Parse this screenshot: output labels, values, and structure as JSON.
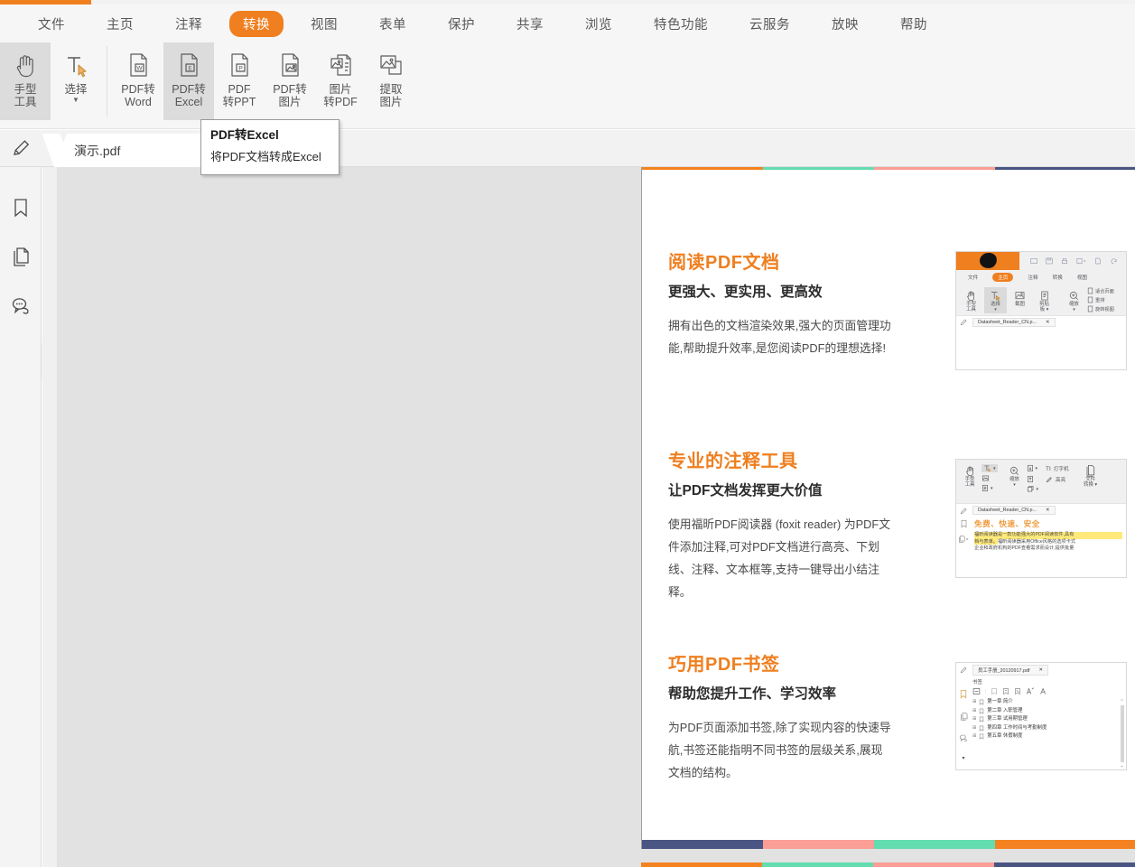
{
  "menubar": {
    "items": [
      {
        "label": "文件",
        "active": false
      },
      {
        "label": "主页",
        "active": false
      },
      {
        "label": "注释",
        "active": false
      },
      {
        "label": "转换",
        "active": true
      },
      {
        "label": "视图",
        "active": false
      },
      {
        "label": "表单",
        "active": false
      },
      {
        "label": "保护",
        "active": false
      },
      {
        "label": "共享",
        "active": false
      },
      {
        "label": "浏览",
        "active": false
      },
      {
        "label": "特色功能",
        "active": false
      },
      {
        "label": "云服务",
        "active": false
      },
      {
        "label": "放映",
        "active": false
      },
      {
        "label": "帮助",
        "active": false
      }
    ]
  },
  "ribbon": {
    "buttons": [
      {
        "name": "hand-tool",
        "label": "手型\n工具",
        "icon": "hand-icon",
        "selected": true,
        "caret": false
      },
      {
        "name": "select-tool",
        "label": "选择",
        "icon": "text-select-icon",
        "selected": false,
        "caret": true
      },
      {
        "name": "pdf-to-word",
        "label": "PDF转\nWord",
        "icon": "doc-word-icon",
        "selected": false,
        "caret": false
      },
      {
        "name": "pdf-to-excel",
        "label": "PDF转\nExcel",
        "icon": "doc-excel-icon",
        "selected": true,
        "caret": false
      },
      {
        "name": "pdf-to-ppt",
        "label": "PDF\n转PPT",
        "icon": "doc-ppt-icon",
        "selected": false,
        "caret": false
      },
      {
        "name": "pdf-to-image",
        "label": "PDF转\n图片",
        "icon": "doc-image-icon",
        "selected": false,
        "caret": false
      },
      {
        "name": "image-to-pdf",
        "label": "图片\n转PDF",
        "icon": "image-to-doc-icon",
        "selected": false,
        "caret": false
      },
      {
        "name": "extract-image",
        "label": "提取\n图片",
        "icon": "extract-image-icon",
        "selected": false,
        "caret": false
      }
    ]
  },
  "tooltip": {
    "title": "PDF转Excel",
    "description": "将PDF文档转成Excel"
  },
  "tabbar": {
    "pencil_icon": "pencil-icon",
    "document_name": "演示.pdf"
  },
  "leftrail": {
    "items": [
      {
        "name": "bookmark-panel",
        "icon": "bookmark-icon"
      },
      {
        "name": "pages-panel",
        "icon": "pages-icon"
      },
      {
        "name": "comments-panel",
        "icon": "comment-icon"
      }
    ],
    "expand_icon": "triangle-right-icon"
  },
  "colors": {
    "accent_orange": "#ef7f1f",
    "bar_orange": "#f58220",
    "bar_teal": "#63dcb0",
    "bar_pink": "#fb9e95",
    "bar_navy": "#4b5584",
    "heading_orange": "#ef7f1f"
  },
  "page": {
    "top_bar": [
      "#f58220",
      "#63dcb0",
      "#fb9e95",
      "#4b5584"
    ],
    "bottom_bar": [
      "#4b5584",
      "#fb9e95",
      "#63dcb0",
      "#f58220"
    ],
    "next_page_bar": [
      "#f58220",
      "#63dcb0",
      "#fb9e95",
      "#4b5584"
    ],
    "sections": [
      {
        "id": "read-pdf",
        "h1": "阅读PDF文档",
        "h2": "更强大、更实用、更高效",
        "p": "拥有出色的文档渲染效果,强大的页面管理功能,帮助提升效率,是您阅读PDF的理想选择!"
      },
      {
        "id": "annotation-tools",
        "h1": "专业的注释工具",
        "h2": "让PDF文档发挥更大价值",
        "p": "使用福昕PDF阅读器 (foxit reader) 为PDF文件添加注释,可对PDF文档进行高亮、下划线、注释、文本框等,支持一键导出小结注释。"
      },
      {
        "id": "pdf-bookmarks",
        "h1": "巧用PDF书签",
        "h2": "帮助您提升工作、学习效率",
        "p": "为PDF页面添加书签,除了实现内容的快速导航,书签还能指明不同书签的层级关系,展现文档的结构。"
      }
    ],
    "mini_shot_1": {
      "menu": [
        "文件",
        "主页",
        "注释",
        "转换",
        "视图"
      ],
      "active_menu": "主页",
      "tools": [
        "手型\n工具",
        "选择",
        "截图",
        "剪贴\n板"
      ],
      "zoom_tool": "缩放",
      "right_items": [
        "适合页面",
        "重排",
        "旋转视图"
      ],
      "file_tab": "Datasheet_Reader_CN.p..."
    },
    "mini_shot_2": {
      "tools": [
        "手型\n工具",
        "缩放",
        "文件\n转换"
      ],
      "typewriter": "打字机",
      "highlight": "高亮",
      "file_tab": "Datasheet_Reader_CN.p...",
      "doc_title": "免费、快速、安全",
      "doc_line1": "福昕阅读器是一款功能强大的PDF阅读软件,具有",
      "doc_line2": "档与表单。福昕阅读器采用Office风格的选项卡式",
      "doc_line3": "企业和政府机构的PDF查看需求而设计,提供批量"
    },
    "mini_shot_3": {
      "file_tab": "员工手册_20120917.pdf",
      "panel_label": "书签",
      "bookmarks": [
        "第一章  简介",
        "第二章  入职管理",
        "第三章  试用期管理",
        "第四章  工作时间与考勤制度",
        "第五章  休假制度"
      ]
    }
  }
}
